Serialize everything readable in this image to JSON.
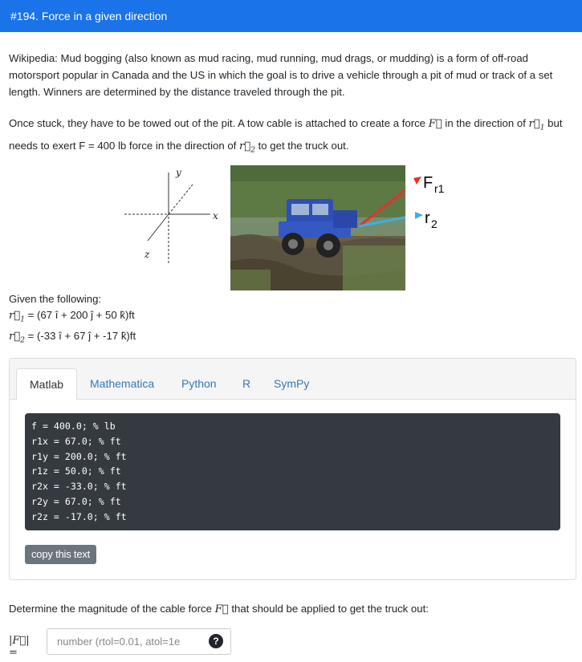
{
  "header": {
    "title": "#194. Force in a given direction"
  },
  "intro": {
    "wiki": "Wikipedia: Mud bogging (also known as mud racing, mud running, mud drags, or mudding) is a form of off-road motorsport popular in Canada and the US in which the goal is to drive a vehicle through a pit of mud or track of a set length. Winners are determined by the distance traveled through the pit.",
    "stuck_a": "Once stuck, they have to be towed out of the pit. A tow cable is attached to create a force ",
    "stuck_b": " in the direction of ",
    "stuck_c": " but needs to exert F = 400 lb force in the direction of ",
    "stuck_d": " to get the truck out."
  },
  "axes": {
    "y": "y",
    "x": "x",
    "z": "z"
  },
  "photo_labels": {
    "f": "F",
    "f_sub": "r1",
    "r": "r",
    "r_sub": "2"
  },
  "given": {
    "title": "Given the following:",
    "r1": "= (67 î + 200 ĵ + 50 k̂)ft",
    "r2": "= (-33 î + 67 ĵ + -17 k̂)ft"
  },
  "tabs": [
    "Matlab",
    "Mathematica",
    "Python",
    "R",
    "SymPy"
  ],
  "code_lines": [
    "f = 400.0; % lb",
    "r1x = 67.0; % ft",
    "r1y = 200.0; % ft",
    "r1z = 50.0; % ft",
    "r2x = -33.0; % ft",
    "r2y = 67.0; % ft",
    "r2z = -17.0; % ft"
  ],
  "copy_label": "copy this text",
  "question": {
    "a": "Determine the magnitude of the cable force ",
    "b": " that should be applied to get the truck out:"
  },
  "answer": {
    "label": "|F| =",
    "placeholder": "number (rtol=0.01, atol=1e",
    "help": "?"
  },
  "colors": {
    "header": "#1a73e8",
    "arrow_f": "#e8302a",
    "arrow_r": "#3ab0e8",
    "code_bg": "#343a40"
  }
}
